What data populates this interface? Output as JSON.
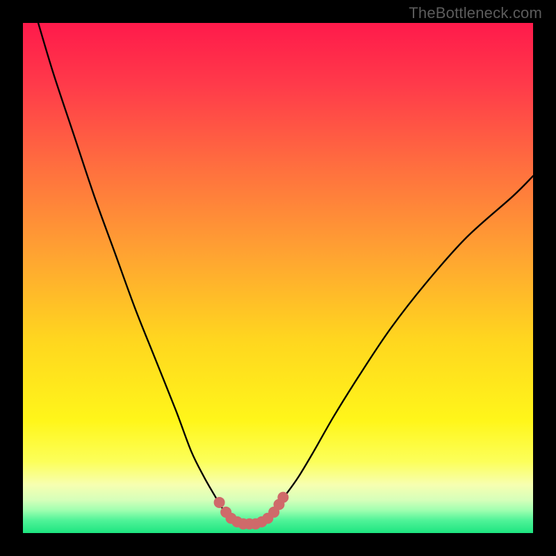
{
  "attribution": "TheBottleneck.com",
  "colors": {
    "gradient_stops": [
      {
        "offset": 0.0,
        "color": "#ff1a4b"
      },
      {
        "offset": 0.12,
        "color": "#ff3a4a"
      },
      {
        "offset": 0.28,
        "color": "#ff6e3f"
      },
      {
        "offset": 0.45,
        "color": "#ffa232"
      },
      {
        "offset": 0.62,
        "color": "#ffd61f"
      },
      {
        "offset": 0.78,
        "color": "#fff61a"
      },
      {
        "offset": 0.86,
        "color": "#fcff5a"
      },
      {
        "offset": 0.905,
        "color": "#f7ffb0"
      },
      {
        "offset": 0.935,
        "color": "#d6ffba"
      },
      {
        "offset": 0.955,
        "color": "#a0ffb0"
      },
      {
        "offset": 0.975,
        "color": "#50f398"
      },
      {
        "offset": 1.0,
        "color": "#1de580"
      }
    ],
    "curve": "#000000",
    "marker": "#cf6a6a"
  },
  "chart_data": {
    "type": "line",
    "title": "",
    "xlabel": "",
    "ylabel": "",
    "xlim": [
      0,
      100
    ],
    "ylim": [
      0,
      100
    ],
    "grid": false,
    "legend": false,
    "series": [
      {
        "name": "bottleneck-curve",
        "x": [
          3,
          6,
          10,
          14,
          18,
          22,
          26,
          30,
          33,
          35.5,
          37.5,
          39,
          40.5,
          42,
          43.5,
          45,
          46.5,
          48,
          49.5,
          51.5,
          54,
          57,
          61,
          66,
          72,
          79,
          87,
          96,
          100
        ],
        "y": [
          100,
          90,
          78,
          66,
          55,
          44,
          34,
          24,
          16,
          11,
          7.5,
          5,
          3.3,
          2.3,
          1.7,
          1.7,
          2.3,
          3.3,
          5,
          7.5,
          11,
          16,
          23,
          31,
          40,
          49,
          58,
          66,
          70
        ]
      }
    ],
    "markers": {
      "name": "bottleneck-floor",
      "points": [
        {
          "x": 38.5,
          "y": 6.0
        },
        {
          "x": 39.8,
          "y": 4.1
        },
        {
          "x": 40.8,
          "y": 2.9
        },
        {
          "x": 42.0,
          "y": 2.2
        },
        {
          "x": 43.2,
          "y": 1.8
        },
        {
          "x": 44.4,
          "y": 1.8
        },
        {
          "x": 45.6,
          "y": 1.8
        },
        {
          "x": 46.8,
          "y": 2.2
        },
        {
          "x": 48.0,
          "y": 2.9
        },
        {
          "x": 49.2,
          "y": 4.1
        },
        {
          "x": 50.2,
          "y": 5.6
        },
        {
          "x": 51.0,
          "y": 7.0
        }
      ]
    }
  }
}
